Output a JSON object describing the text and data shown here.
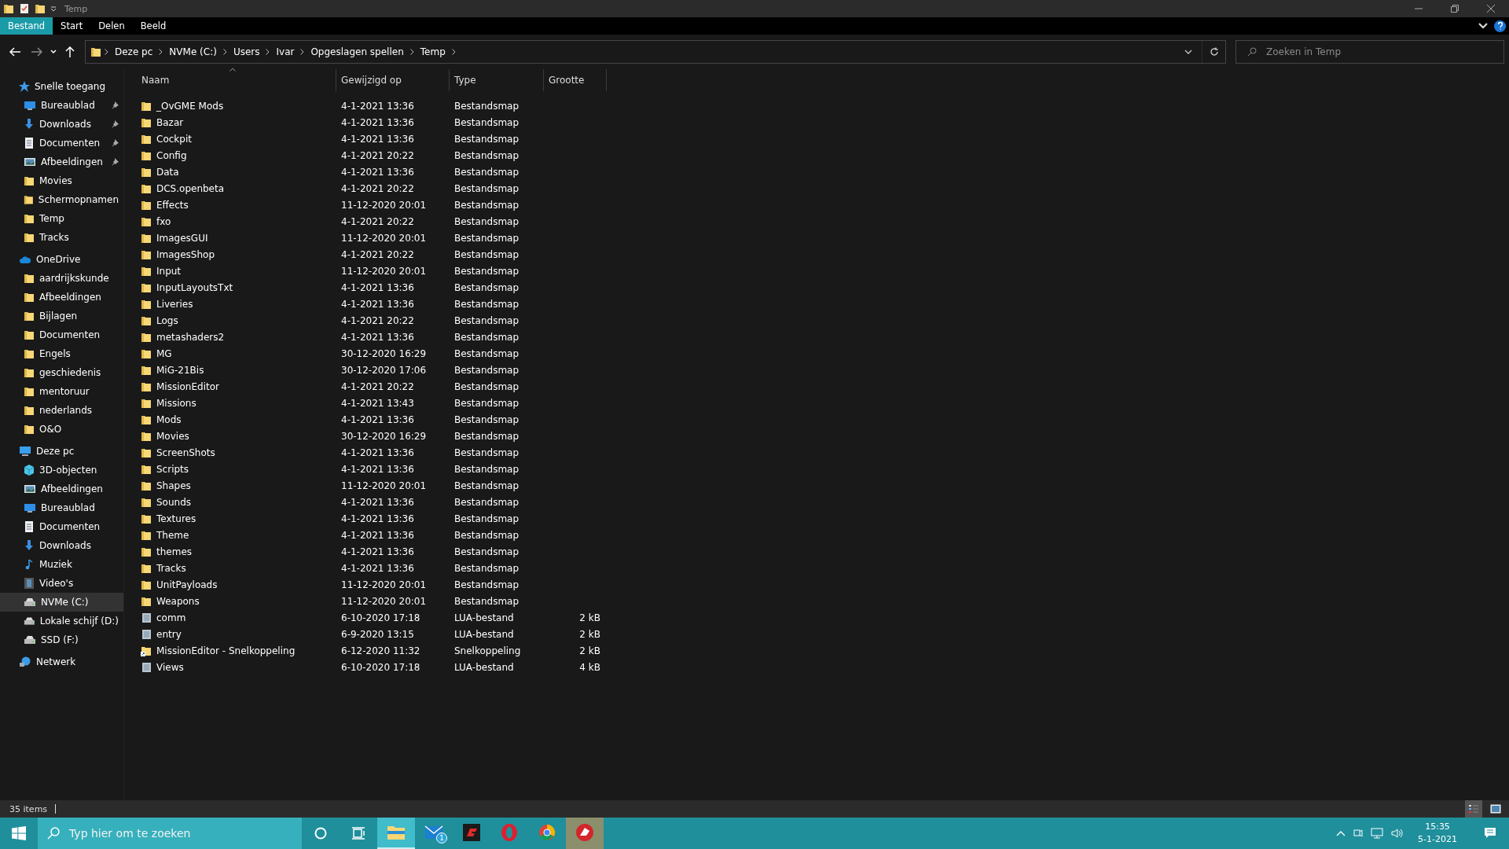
{
  "window": {
    "title": "Temp"
  },
  "ribbon_tabs": [
    {
      "label": "Bestand",
      "selected": true
    },
    {
      "label": "Start",
      "selected": false
    },
    {
      "label": "Delen",
      "selected": false
    },
    {
      "label": "Beeld",
      "selected": false
    }
  ],
  "breadcrumb": [
    "Deze pc",
    "NVMe (C:)",
    "Users",
    "Ivar",
    "Opgeslagen spellen",
    "Temp"
  ],
  "search": {
    "placeholder": "Zoeken in Temp"
  },
  "sidebar": [
    {
      "label": "Snelle toegang",
      "kind": "star",
      "children": [
        {
          "label": "Bureaublad",
          "kind": "desktop",
          "pinned": true,
          "selected": false
        },
        {
          "label": "Downloads",
          "kind": "download",
          "pinned": true,
          "selected": false
        },
        {
          "label": "Documenten",
          "kind": "document",
          "pinned": true,
          "selected": false
        },
        {
          "label": "Afbeeldingen",
          "kind": "picture",
          "pinned": true,
          "selected": false
        },
        {
          "label": "Movies",
          "kind": "folder",
          "pinned": false,
          "selected": false
        },
        {
          "label": "Schermopnamen",
          "kind": "folder",
          "pinned": false,
          "selected": false
        },
        {
          "label": "Temp",
          "kind": "folder",
          "pinned": false,
          "selected": false
        },
        {
          "label": "Tracks",
          "kind": "folder",
          "pinned": false,
          "selected": false
        }
      ]
    },
    {
      "label": "OneDrive",
      "kind": "cloud",
      "children": [
        {
          "label": "aardrijkskunde",
          "kind": "folder",
          "pinned": false,
          "selected": false
        },
        {
          "label": "Afbeeldingen",
          "kind": "folder",
          "pinned": false,
          "selected": false
        },
        {
          "label": "Bijlagen",
          "kind": "folder",
          "pinned": false,
          "selected": false
        },
        {
          "label": "Documenten",
          "kind": "folder",
          "pinned": false,
          "selected": false
        },
        {
          "label": "Engels",
          "kind": "folder",
          "pinned": false,
          "selected": false
        },
        {
          "label": "geschiedenis",
          "kind": "folder",
          "pinned": false,
          "selected": false
        },
        {
          "label": "mentoruur",
          "kind": "folder",
          "pinned": false,
          "selected": false
        },
        {
          "label": "nederlands",
          "kind": "folder",
          "pinned": false,
          "selected": false
        },
        {
          "label": "O&O",
          "kind": "folder",
          "pinned": false,
          "selected": false
        }
      ]
    },
    {
      "label": "Deze pc",
      "kind": "computer",
      "children": [
        {
          "label": "3D-objecten",
          "kind": "cube",
          "pinned": false,
          "selected": false
        },
        {
          "label": "Afbeeldingen",
          "kind": "picture",
          "pinned": false,
          "selected": false
        },
        {
          "label": "Bureaublad",
          "kind": "desktop",
          "pinned": false,
          "selected": false
        },
        {
          "label": "Documenten",
          "kind": "document",
          "pinned": false,
          "selected": false
        },
        {
          "label": "Downloads",
          "kind": "download",
          "pinned": false,
          "selected": false
        },
        {
          "label": "Muziek",
          "kind": "music",
          "pinned": false,
          "selected": false
        },
        {
          "label": "Video's",
          "kind": "video",
          "pinned": false,
          "selected": false
        },
        {
          "label": "NVMe (C:)",
          "kind": "drive",
          "pinned": false,
          "selected": true
        },
        {
          "label": "Lokale schijf (D:)",
          "kind": "drive",
          "pinned": false,
          "selected": false
        },
        {
          "label": "SSD (F:)",
          "kind": "drive",
          "pinned": false,
          "selected": false
        }
      ]
    },
    {
      "label": "Netwerk",
      "kind": "network"
    }
  ],
  "table": {
    "columns": [
      "Naam",
      "Gewijzigd op",
      "Type",
      "Grootte"
    ],
    "rows": [
      {
        "kind": "folder",
        "name": "_OvGME Mods",
        "modified": "4-1-2021 13:36",
        "type": "Bestandsmap"
      },
      {
        "kind": "folder",
        "name": "Bazar",
        "modified": "4-1-2021 13:36",
        "type": "Bestandsmap"
      },
      {
        "kind": "folder",
        "name": "Cockpit",
        "modified": "4-1-2021 13:36",
        "type": "Bestandsmap"
      },
      {
        "kind": "folder",
        "name": "Config",
        "modified": "4-1-2021 20:22",
        "type": "Bestandsmap"
      },
      {
        "kind": "folder",
        "name": "Data",
        "modified": "4-1-2021 13:36",
        "type": "Bestandsmap"
      },
      {
        "kind": "folder",
        "name": "DCS.openbeta",
        "modified": "4-1-2021 20:22",
        "type": "Bestandsmap"
      },
      {
        "kind": "folder",
        "name": "Effects",
        "modified": "11-12-2020 20:01",
        "type": "Bestandsmap"
      },
      {
        "kind": "folder",
        "name": "fxo",
        "modified": "4-1-2021 20:22",
        "type": "Bestandsmap"
      },
      {
        "kind": "folder",
        "name": "ImagesGUI",
        "modified": "11-12-2020 20:01",
        "type": "Bestandsmap"
      },
      {
        "kind": "folder",
        "name": "ImagesShop",
        "modified": "4-1-2021 20:22",
        "type": "Bestandsmap"
      },
      {
        "kind": "folder",
        "name": "Input",
        "modified": "11-12-2020 20:01",
        "type": "Bestandsmap"
      },
      {
        "kind": "folder",
        "name": "InputLayoutsTxt",
        "modified": "4-1-2021 13:36",
        "type": "Bestandsmap"
      },
      {
        "kind": "folder",
        "name": "Liveries",
        "modified": "4-1-2021 13:36",
        "type": "Bestandsmap"
      },
      {
        "kind": "folder",
        "name": "Logs",
        "modified": "4-1-2021 20:22",
        "type": "Bestandsmap"
      },
      {
        "kind": "folder",
        "name": "metashaders2",
        "modified": "4-1-2021 13:36",
        "type": "Bestandsmap"
      },
      {
        "kind": "folder",
        "name": "MG",
        "modified": "30-12-2020 16:29",
        "type": "Bestandsmap"
      },
      {
        "kind": "folder",
        "name": "MiG-21Bis",
        "modified": "30-12-2020 17:06",
        "type": "Bestandsmap"
      },
      {
        "kind": "folder",
        "name": "MissionEditor",
        "modified": "4-1-2021 20:22",
        "type": "Bestandsmap"
      },
      {
        "kind": "folder",
        "name": "Missions",
        "modified": "4-1-2021 13:43",
        "type": "Bestandsmap"
      },
      {
        "kind": "folder",
        "name": "Mods",
        "modified": "4-1-2021 13:36",
        "type": "Bestandsmap"
      },
      {
        "kind": "folder",
        "name": "Movies",
        "modified": "30-12-2020 16:29",
        "type": "Bestandsmap"
      },
      {
        "kind": "folder",
        "name": "ScreenShots",
        "modified": "4-1-2021 13:36",
        "type": "Bestandsmap"
      },
      {
        "kind": "folder",
        "name": "Scripts",
        "modified": "4-1-2021 13:36",
        "type": "Bestandsmap"
      },
      {
        "kind": "folder",
        "name": "Shapes",
        "modified": "11-12-2020 20:01",
        "type": "Bestandsmap"
      },
      {
        "kind": "folder",
        "name": "Sounds",
        "modified": "4-1-2021 13:36",
        "type": "Bestandsmap"
      },
      {
        "kind": "folder",
        "name": "Textures",
        "modified": "4-1-2021 13:36",
        "type": "Bestandsmap"
      },
      {
        "kind": "folder",
        "name": "Theme",
        "modified": "4-1-2021 13:36",
        "type": "Bestandsmap"
      },
      {
        "kind": "folder",
        "name": "themes",
        "modified": "4-1-2021 13:36",
        "type": "Bestandsmap"
      },
      {
        "kind": "folder",
        "name": "Tracks",
        "modified": "4-1-2021 13:36",
        "type": "Bestandsmap"
      },
      {
        "kind": "folder",
        "name": "UnitPayloads",
        "modified": "11-12-2020 20:01",
        "type": "Bestandsmap"
      },
      {
        "kind": "folder",
        "name": "Weapons",
        "modified": "11-12-2020 20:01",
        "type": "Bestandsmap"
      },
      {
        "kind": "file",
        "name": "comm",
        "modified": "6-10-2020 17:18",
        "type": "LUA-bestand",
        "size": "2 kB"
      },
      {
        "kind": "file",
        "name": "entry",
        "modified": "6-9-2020 13:15",
        "type": "LUA-bestand",
        "size": "2 kB"
      },
      {
        "kind": "shortcut",
        "name": "MissionEditor - Snelkoppeling",
        "modified": "6-12-2020 11:32",
        "type": "Snelkoppeling",
        "size": "2 kB"
      },
      {
        "kind": "file",
        "name": "Views",
        "modified": "6-10-2020 17:18",
        "type": "LUA-bestand",
        "size": "4 kB"
      }
    ]
  },
  "status_bar": {
    "count": "35 items"
  },
  "taskbar": {
    "search": {
      "placeholder": "Typ hier om te zoeken"
    },
    "apps": [
      {
        "kind": "explorer",
        "selected": true
      },
      {
        "kind": "mail",
        "selected": false,
        "badge": "1"
      },
      {
        "kind": "game",
        "selected": false
      },
      {
        "kind": "opera",
        "selected": false
      },
      {
        "kind": "chrome",
        "selected": false
      },
      {
        "kind": "wot",
        "selected": false
      }
    ],
    "time": "15:35",
    "date": "5-1-2021"
  }
}
